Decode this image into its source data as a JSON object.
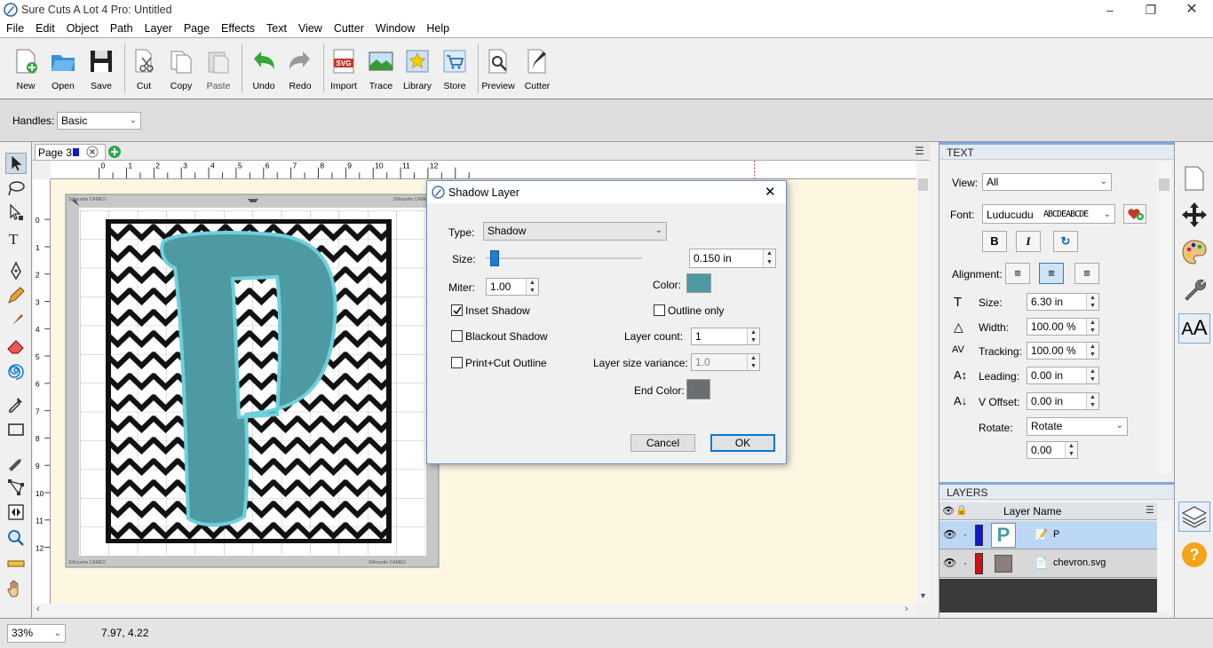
{
  "window": {
    "title": "Sure Cuts A Lot 4 Pro: Untitled"
  },
  "menu": [
    "File",
    "Edit",
    "Object",
    "Path",
    "Layer",
    "Page",
    "Effects",
    "Text",
    "View",
    "Cutter",
    "Window",
    "Help"
  ],
  "toolbar": {
    "new": "New",
    "open": "Open",
    "save": "Save",
    "cut": "Cut",
    "copy": "Copy",
    "paste": "Paste",
    "undo": "Undo",
    "redo": "Redo",
    "import": "Import",
    "trace": "Trace",
    "library": "Library",
    "store": "Store",
    "preview": "Preview",
    "cutter": "Cutter"
  },
  "handles": {
    "label": "Handles:",
    "value": "Basic"
  },
  "page_tab": {
    "label": "Page 3"
  },
  "ruler": {
    "h_ticks": [
      "0",
      "1",
      "2",
      "3",
      "4",
      "5",
      "6",
      "7",
      "8",
      "9",
      "10",
      "11",
      "12"
    ],
    "v_ticks": [
      "0",
      "1",
      "2",
      "3",
      "4",
      "5",
      "6",
      "7",
      "8",
      "9",
      "10",
      "11",
      "12"
    ]
  },
  "mat": {
    "label": "Silhouette CAMEO"
  },
  "status": {
    "zoom": "33%",
    "coords": "7.97, 4.22"
  },
  "text_panel": {
    "header": "TEXT",
    "view_label": "View:",
    "view_value": "All",
    "font_label": "Font:",
    "font_value": "Luducudu",
    "font_preview": "ABCDEABCDE",
    "bold": "B",
    "italic": "I",
    "alignment_label": "Alignment:",
    "size_label": "Size:",
    "size_value": "6.30 in",
    "width_label": "Width:",
    "width_value": "100.00 %",
    "tracking_label": "Tracking:",
    "tracking_value": "100.00 %",
    "leading_label": "Leading:",
    "leading_value": "0.00 in",
    "voffset_label": "V Offset:",
    "voffset_value": "0.00 in",
    "rotate_label": "Rotate:",
    "rotate_value": "Rotate",
    "rotate_amount": "0.00"
  },
  "layers_panel": {
    "header": "LAYERS",
    "col_name": "Layer Name",
    "layers": [
      {
        "name": "P",
        "color": "#1018c8",
        "thumb_letter": "P"
      },
      {
        "name": "chevron.svg",
        "color": "#d01010"
      }
    ]
  },
  "dialog": {
    "title": "Shadow Layer",
    "type_label": "Type:",
    "type_value": "Shadow",
    "size_label": "Size:",
    "size_value": "0.150 in",
    "size_fraction": 0.05,
    "miter_label": "Miter:",
    "miter_value": "1.00",
    "color_label": "Color:",
    "color_value": "#4e9aa2",
    "inset_label": "Inset Shadow",
    "inset_checked": true,
    "outline_label": "Outline only",
    "outline_checked": false,
    "blackout_label": "Blackout Shadow",
    "blackout_checked": false,
    "printcut_label": "Print+Cut Outline",
    "printcut_checked": false,
    "layercount_label": "Layer count:",
    "layercount_value": "1",
    "variance_label": "Layer size variance:",
    "variance_value": "1.0",
    "endcolor_label": "End Color:",
    "endcolor_value": "#6a6e70",
    "cancel": "Cancel",
    "ok": "OK"
  },
  "colors": {
    "letter": "#4e9aa2",
    "letter_outline": "#6fd0dc",
    "canvas_bg": "#fdf7e2"
  }
}
